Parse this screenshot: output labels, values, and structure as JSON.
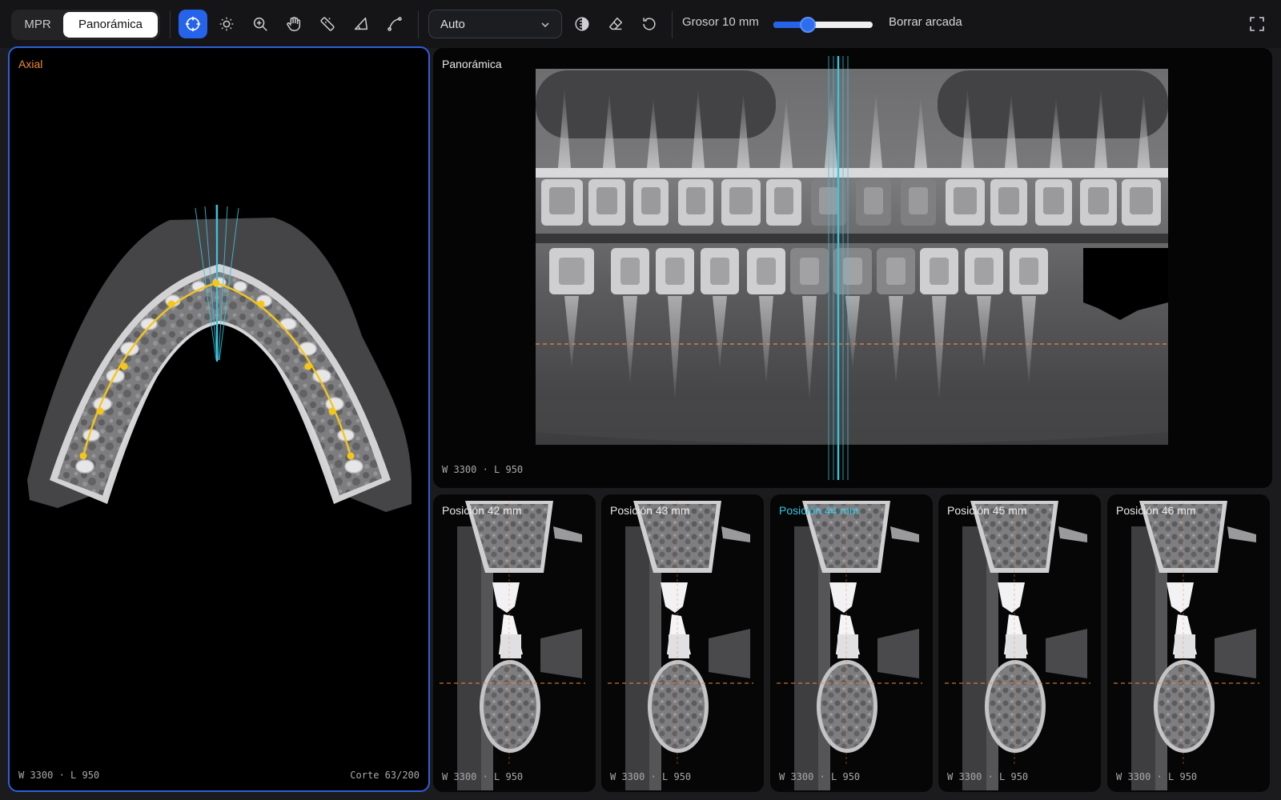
{
  "toolbar": {
    "mode_tabs": [
      "MPR",
      "Panorámica"
    ],
    "active_tab": "Panorámica",
    "tools": [
      {
        "icon": "crosshair-icon",
        "active": true
      },
      {
        "icon": "brightness-icon",
        "active": false
      },
      {
        "icon": "zoom-in-icon",
        "active": false
      },
      {
        "icon": "hand-pan-icon",
        "active": false
      },
      {
        "icon": "ruler-icon",
        "active": false
      },
      {
        "icon": "angle-icon",
        "active": false
      },
      {
        "icon": "curve-icon",
        "active": false
      }
    ],
    "preset_value": "Auto",
    "extra_tools": [
      "invert-icon",
      "eraser-icon",
      "reset-icon"
    ],
    "thickness_label": "Grosor 10 mm",
    "thickness_fraction": 0.35,
    "clear_arch_label": "Borrar arcada",
    "accent": "#2563eb"
  },
  "axial": {
    "title": "Axial",
    "window_level": "W 3300 · L 950",
    "slice": "Corte 63/200",
    "title_color": "#f08a3c",
    "arch_color": "#f5c518",
    "guide_color": "#38c6e0"
  },
  "panoramic": {
    "title": "Panorámica",
    "window_level": "W 3300 · L 950"
  },
  "cross_sections": [
    {
      "title": "Posición 42 mm",
      "window_level": "W 3300 · L 950",
      "active": false
    },
    {
      "title": "Posición 43 mm",
      "window_level": "W 3300 · L 950",
      "active": false
    },
    {
      "title": "Posición 44 mm",
      "window_level": "W 3300 · L 950",
      "active": true
    },
    {
      "title": "Posición 45 mm",
      "window_level": "W 3300 · L 950",
      "active": false
    },
    {
      "title": "Posición 46 mm",
      "window_level": "W 3300 · L 950",
      "active": false
    }
  ]
}
